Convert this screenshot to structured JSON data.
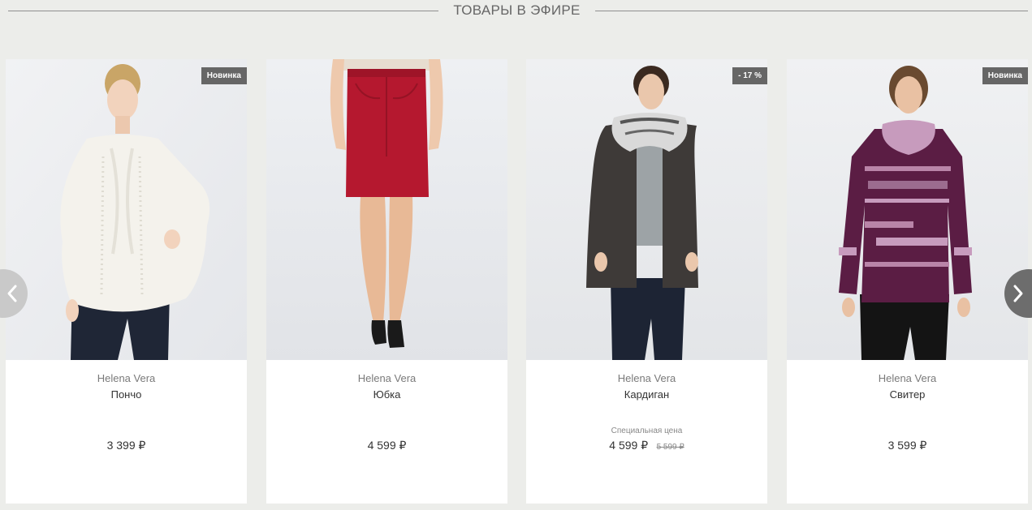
{
  "section": {
    "title": "ТОВАРЫ В ЭФИРЕ"
  },
  "products": [
    {
      "brand": "Helena Vera",
      "name": "Пончо",
      "badge": "Новинка",
      "price": "3 399 ₽"
    },
    {
      "brand": "Helena Vera",
      "name": "Юбка",
      "price": "4 599 ₽"
    },
    {
      "brand": "Helena Vera",
      "name": "Кардиган",
      "badge": "- 17 %",
      "special_label": "Специальная цена",
      "price": "4 599 ₽",
      "old_price": "5 599 ₽"
    },
    {
      "brand": "Helena Vera",
      "name": "Свитер",
      "badge": "Новинка",
      "price": "3 599 ₽"
    }
  ],
  "nav": {
    "prev_icon": "chevron-left-icon",
    "next_icon": "chevron-right-icon"
  },
  "colors": {
    "background": "#ecedea",
    "badge": "#666666",
    "arrow_prev": "#c9c9c9",
    "arrow_next": "#6d6d6d"
  }
}
